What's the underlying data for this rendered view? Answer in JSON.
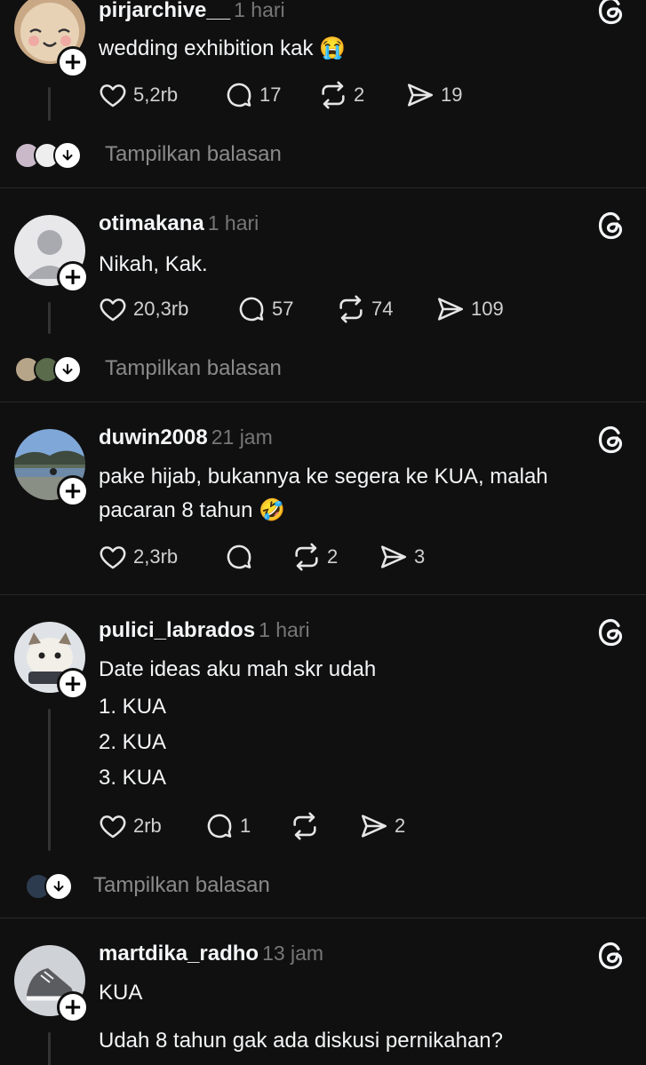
{
  "icons": {
    "like": "heart-icon",
    "reply": "speech-bubble-icon",
    "repost": "repost-icon",
    "share": "send-icon",
    "threads": "threads-logo-icon",
    "follow": "plus-icon",
    "expand": "arrow-down-icon"
  },
  "colors": {
    "background": "#101010",
    "text": "#f3f5f7",
    "muted": "#777777",
    "divider": "#2a2a2a"
  },
  "posts": [
    {
      "username": "pirjarchive__",
      "time": "1 hari",
      "lines": [
        "wedding exhibition kak 😭"
      ],
      "likes": "5,2rb",
      "replies": "17",
      "reposts": "2",
      "shares": "19",
      "show_replies": "Tampilkan balasan"
    },
    {
      "username": "otimakana",
      "time": "1 hari",
      "lines": [
        "Nikah, Kak."
      ],
      "likes": "20,3rb",
      "replies": "57",
      "reposts": "74",
      "shares": "109",
      "show_replies": "Tampilkan balasan"
    },
    {
      "username": "duwin2008",
      "time": "21 jam",
      "lines": [
        "pake hijab, bukannya ke segera ke KUA, malah",
        "pacaran 8 tahun 🤣"
      ],
      "likes": "2,3rb",
      "replies": "",
      "reposts": "2",
      "shares": "3"
    },
    {
      "username": "pulici_labrados",
      "time": "1 hari",
      "lines": [
        "Date ideas aku mah skr udah",
        "1. KUA",
        "2. KUA",
        "3. KUA"
      ],
      "likes": "2rb",
      "replies": "1",
      "reposts": "",
      "shares": "2",
      "show_replies": "Tampilkan balasan"
    },
    {
      "username": "martdika_radho",
      "time": "13 jam",
      "lines": [
        "KUA",
        "Udah 8 tahun gak ada diskusi pernikahan?"
      ]
    }
  ]
}
